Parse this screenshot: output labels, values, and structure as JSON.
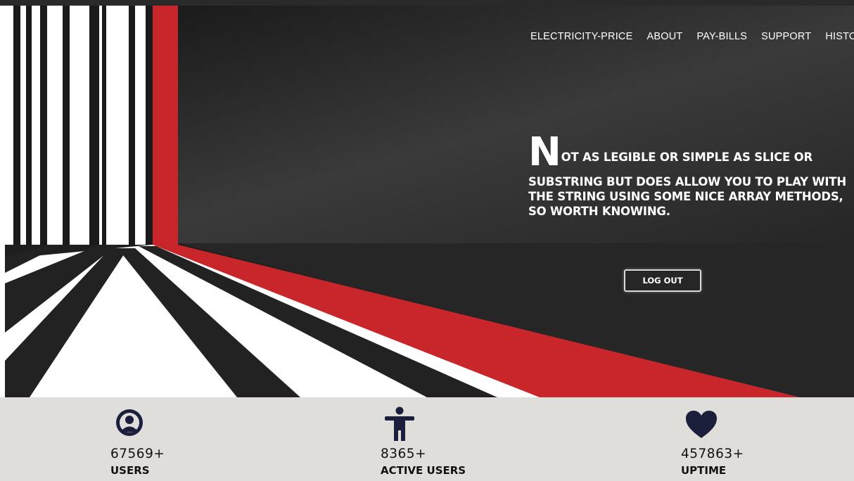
{
  "nav": {
    "items": [
      "ELECTRICITY-PRICE",
      "ABOUT",
      "PAY-BILLS",
      "SUPPORT",
      "HISTO"
    ]
  },
  "hero": {
    "first_letter": "N",
    "line1_rest": "OT AS LEGIBLE OR SIMPLE AS SLICE OR",
    "line2": "SUBSTRING BUT DOES ALLOW YOU TO PLAY WITH THE STRING USING SOME NICE ARRAY METHODS, SO WORTH KNOWING.",
    "logout_label": "LOG OUT"
  },
  "stats": [
    {
      "icon": "user-circle-icon",
      "value": "67569+",
      "label": "USERS"
    },
    {
      "icon": "accessibility-person-icon",
      "value": "8365+",
      "label": "ACTIVE USERS"
    },
    {
      "icon": "heart-icon",
      "value": "457863+",
      "label": "UPTIME"
    }
  ],
  "colors": {
    "accent_red": "#c8262a",
    "icon_navy": "#1c1f3b",
    "stats_background": "#dfdedb",
    "hero_dark": "#1c1c1c"
  }
}
